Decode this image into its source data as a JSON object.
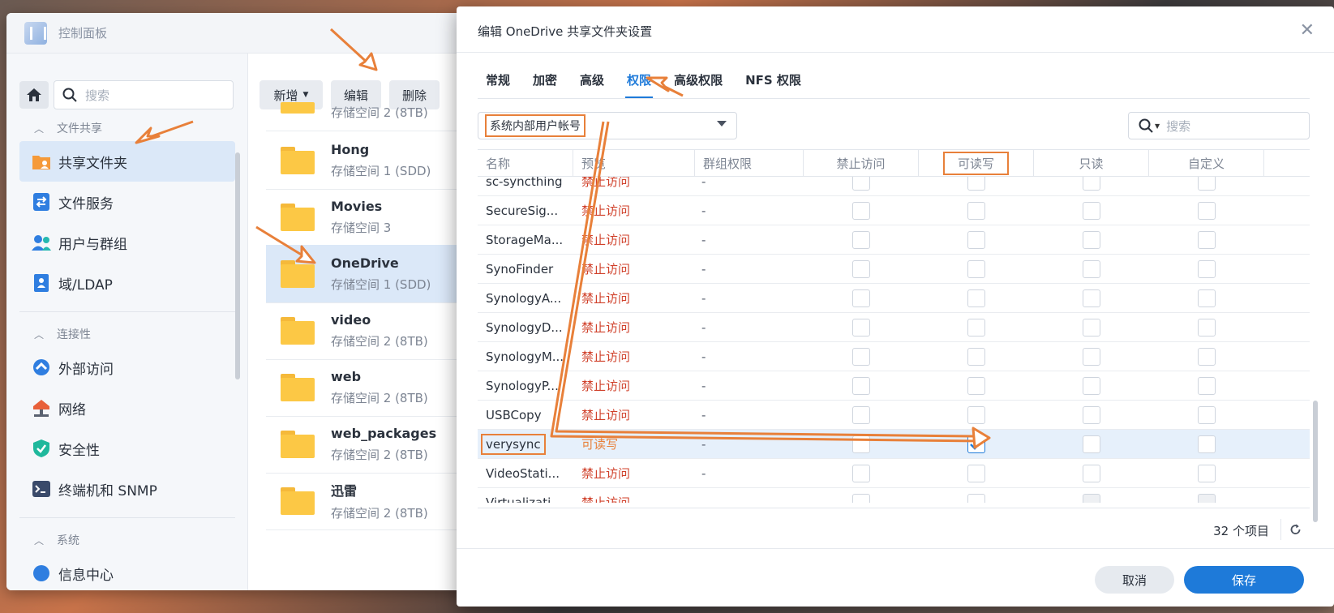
{
  "control_panel": {
    "title": "控制面板",
    "search_placeholder": "搜索",
    "sections": {
      "file_sharing": "文件共享",
      "connectivity": "连接性",
      "system": "系统"
    },
    "nav": {
      "shared_folder": "共享文件夹",
      "file_services": "文件服务",
      "user_group": "用户与群组",
      "domain_ldap": "域/LDAP",
      "external_access": "外部访问",
      "network": "网络",
      "security": "安全性",
      "terminal_snmp": "终端机和 SNMP",
      "info_center": "信息中心"
    },
    "toolbar": {
      "add": "新增",
      "edit": "编辑",
      "delete": "删除"
    },
    "folders": [
      {
        "name": "",
        "sub": "存储空间 2 (8TB)"
      },
      {
        "name": "Hong",
        "sub": "存储空间 1 (SDD)"
      },
      {
        "name": "Movies",
        "sub": "存储空间 3"
      },
      {
        "name": "OneDrive",
        "sub": "存储空间 1 (SDD)"
      },
      {
        "name": "video",
        "sub": "存储空间 2 (8TB)"
      },
      {
        "name": "web",
        "sub": "存储空间 2 (8TB)"
      },
      {
        "name": "web_packages",
        "sub": "存储空间 2 (8TB)"
      },
      {
        "name": "迅雷",
        "sub": "存储空间 2 (8TB)"
      }
    ]
  },
  "dialog": {
    "title": "编辑 OneDrive 共享文件夹设置",
    "tabs": [
      "常规",
      "加密",
      "高级",
      "权限",
      "高级权限",
      "NFS 权限"
    ],
    "active_tab": "权限",
    "user_type": "系统内部用户帐号",
    "search_placeholder": "搜索",
    "columns": {
      "name": "名称",
      "preview": "预览",
      "group_perm": "群组权限",
      "no_access": "禁止访问",
      "read_write": "可读写",
      "read_only": "只读",
      "custom": "自定义"
    },
    "rows": [
      {
        "name": "sc-syncthing",
        "preview": "禁止访问",
        "group": "-"
      },
      {
        "name": "SecureSig...",
        "preview": "禁止访问",
        "group": "-"
      },
      {
        "name": "StorageMa...",
        "preview": "禁止访问",
        "group": "-"
      },
      {
        "name": "SynoFinder",
        "preview": "禁止访问",
        "group": "-"
      },
      {
        "name": "SynologyA...",
        "preview": "禁止访问",
        "group": "-"
      },
      {
        "name": "SynologyD...",
        "preview": "禁止访问",
        "group": "-"
      },
      {
        "name": "SynologyM...",
        "preview": "禁止访问",
        "group": "-"
      },
      {
        "name": "SynologyP...",
        "preview": "禁止访问",
        "group": "-"
      },
      {
        "name": "USBCopy",
        "preview": "禁止访问",
        "group": "-"
      },
      {
        "name": "verysync",
        "preview": "可读写",
        "group": "-"
      },
      {
        "name": "VideoStati...",
        "preview": "禁止访问",
        "group": "-"
      },
      {
        "name": "Virtualizati...",
        "preview": "禁止访问",
        "group": "-"
      }
    ],
    "item_count": "32 个项目",
    "cancel": "取消",
    "save": "保存"
  },
  "colors": {
    "accent": "#1e7ad9",
    "annotation": "#e8803a",
    "deny": "#d0402a"
  }
}
